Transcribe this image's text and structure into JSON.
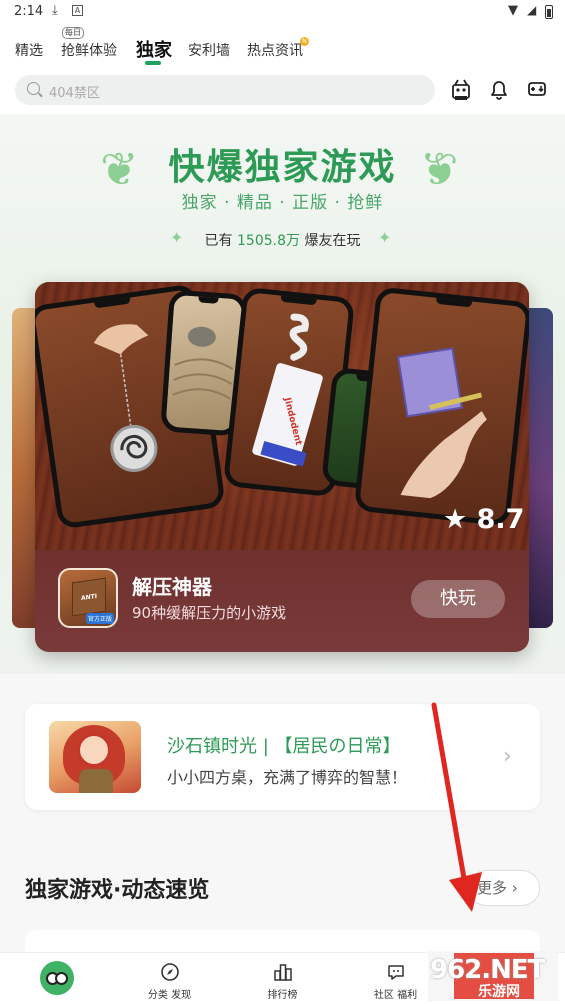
{
  "status_bar": {
    "time": "2:14"
  },
  "tabs": [
    {
      "label": "精选"
    },
    {
      "label": "抢鲜体验",
      "badge": "每日"
    },
    {
      "label": "独家",
      "active": true
    },
    {
      "label": "安利墙"
    },
    {
      "label": "热点资讯",
      "dot": "N"
    }
  ],
  "search": {
    "placeholder": "404禁区"
  },
  "hero": {
    "title": "快爆独家游戏",
    "subtitle": "独家 · 精品 · 正版 · 抢鲜",
    "count_prefix": "已有",
    "count": "1505.8万",
    "count_suffix": "爆友在玩"
  },
  "featured": {
    "rating": "★ 8.7",
    "name": "解压神器",
    "desc": "90种缓解压力的小游戏",
    "play_label": "快玩",
    "icon_tag": "官方正版",
    "icon_text": "ANTI STRESS"
  },
  "promo": {
    "title": "沙石镇时光 | 【居民の日常】",
    "desc": "小小四方桌，充满了博弈的智慧！"
  },
  "section": {
    "title": "独家游戏·动态速览",
    "more": "更多"
  },
  "bottom_nav": [
    {
      "label": ""
    },
    {
      "label": "分类 发现"
    },
    {
      "label": "排行榜"
    },
    {
      "label": "社区 福利"
    },
    {
      "label": ""
    }
  ],
  "watermark": {
    "brand": "962.NET",
    "sub": "乐游网"
  },
  "colors": {
    "accent": "#2d9a55",
    "card": "#6d2c1d",
    "arrow": "#e0271f"
  }
}
